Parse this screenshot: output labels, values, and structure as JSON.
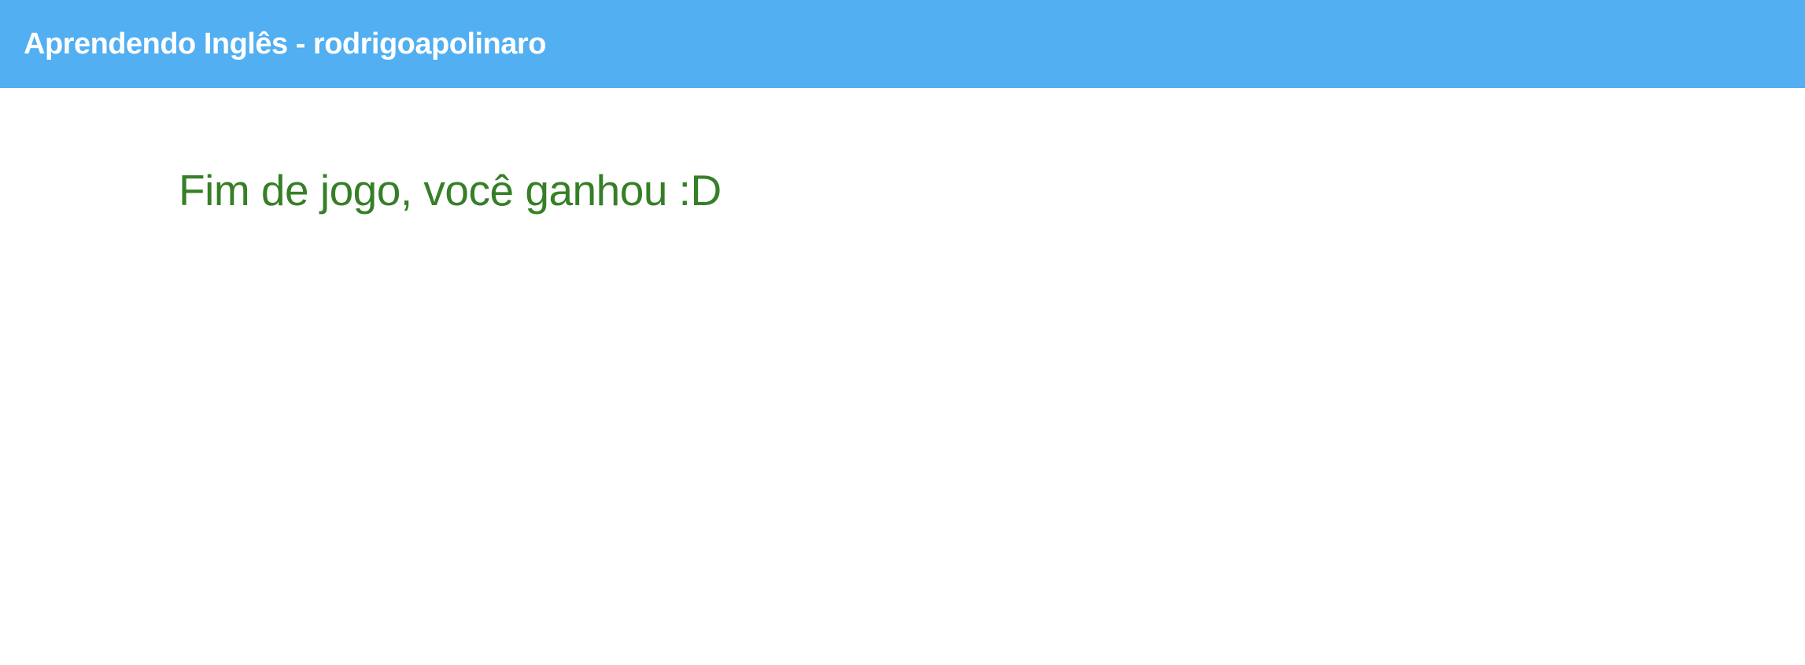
{
  "header": {
    "title": "Aprendendo Inglês - rodrigoapolinaro",
    "background_color": "#51aff2",
    "text_color": "#ffffff"
  },
  "main": {
    "result_message": "Fim de jogo, você ganhou :D",
    "result_color": "#367f27"
  }
}
